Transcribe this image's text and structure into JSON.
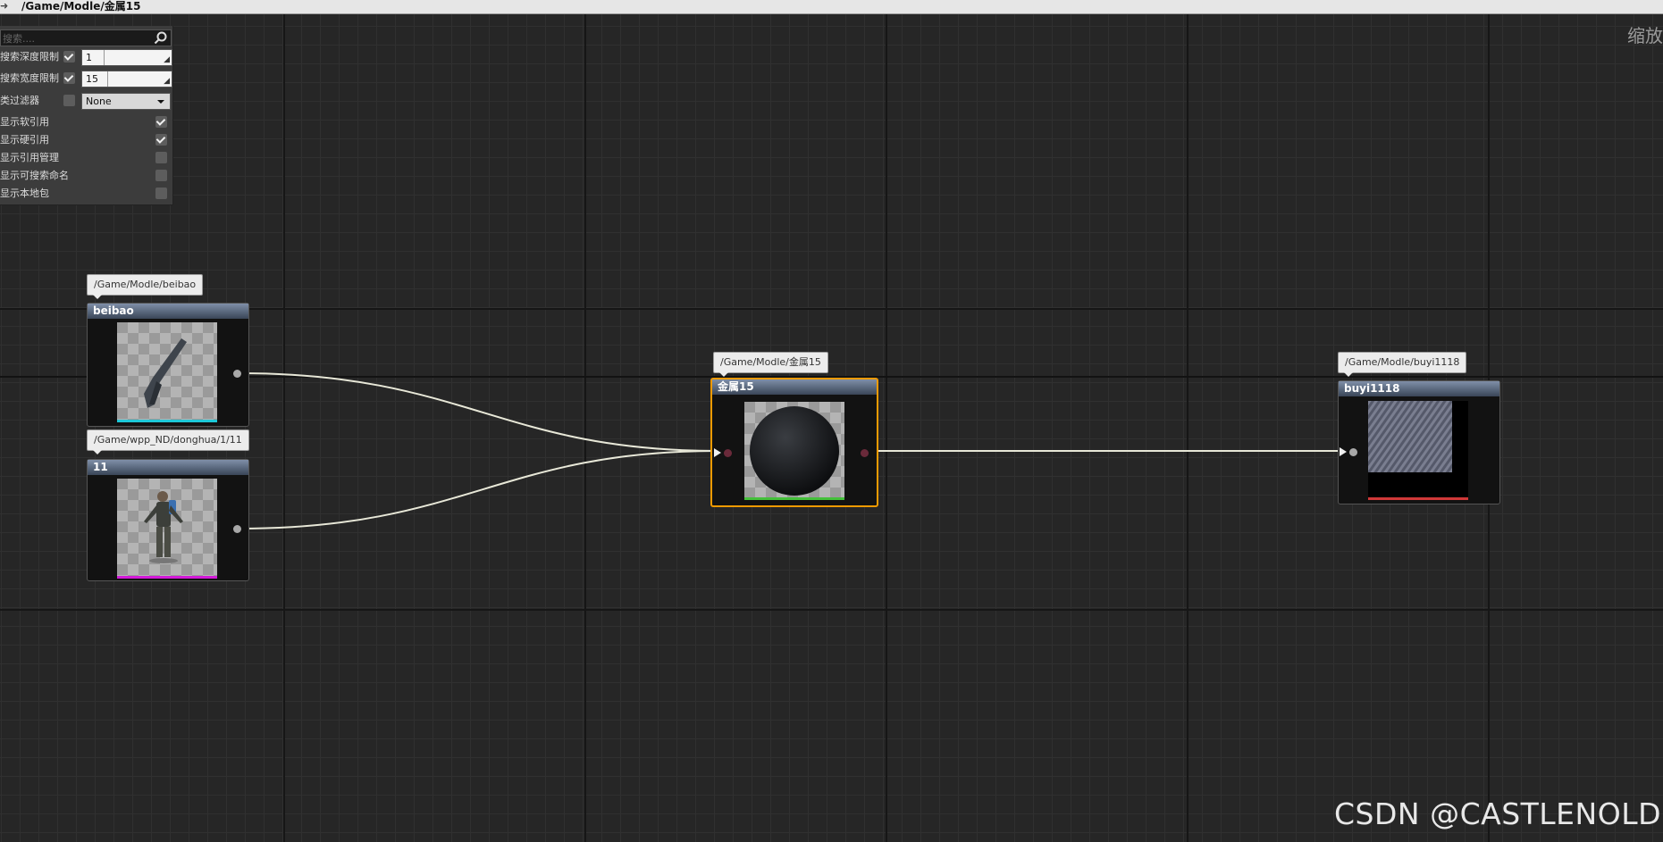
{
  "window": {
    "path": "/Game/Modle/金属15",
    "zoom_label": "缩放"
  },
  "panel": {
    "search_placeholder": "搜索....",
    "rows": [
      {
        "label": "搜索深度限制",
        "checked": true,
        "value": "1"
      },
      {
        "label": "搜索宽度限制",
        "checked": true,
        "value": "15"
      },
      {
        "label": "类过滤器",
        "checked": false,
        "value": "None"
      },
      {
        "label": "显示软引用",
        "checked": true
      },
      {
        "label": "显示硬引用",
        "checked": true
      },
      {
        "label": "显示引用管理",
        "checked": false
      },
      {
        "label": "显示可搜索命名",
        "checked": false
      },
      {
        "label": "显示本地包",
        "checked": false
      }
    ]
  },
  "nodes": {
    "beibao": {
      "path": "/Game/Modle/beibao",
      "title": "beibao",
      "color": "#1ec8d8"
    },
    "donghua": {
      "path": "/Game/wpp_ND/donghua/1/11",
      "title": "11",
      "color": "#d21ad8"
    },
    "metal": {
      "path": "/Game/Modle/金属15",
      "title": "金属15",
      "color": "#44c03a"
    },
    "buyi": {
      "path": "/Game/Modle/buyi1118",
      "title": "buyi1118",
      "color": "#d03838"
    }
  },
  "watermark": "CSDN @CASTLENOLD",
  "colors": {
    "selection": "#f09a00",
    "wire": "#e8e8d8"
  }
}
